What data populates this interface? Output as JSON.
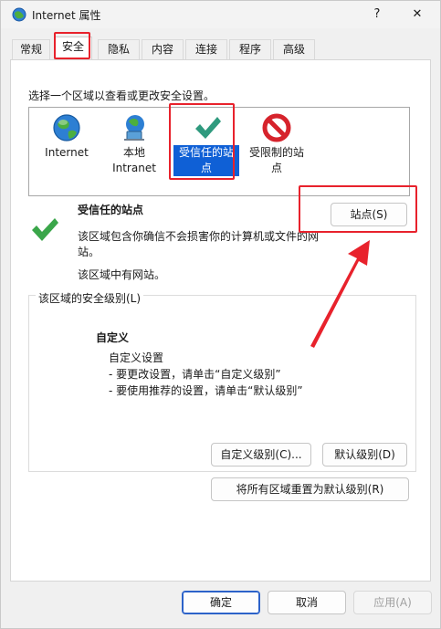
{
  "window": {
    "title": "Internet 属性",
    "help_glyph": "?",
    "close_glyph": "✕"
  },
  "tabs": [
    {
      "label": "常规"
    },
    {
      "label": "安全",
      "active": true
    },
    {
      "label": "隐私"
    },
    {
      "label": "内容"
    },
    {
      "label": "连接"
    },
    {
      "label": "程序"
    },
    {
      "label": "高级"
    }
  ],
  "security": {
    "instruction": "选择一个区域以查看或更改安全设置。",
    "zones": [
      {
        "label": "Internet",
        "icon": "globe-icon"
      },
      {
        "label": "本地\nIntranet",
        "icon": "intranet-icon"
      },
      {
        "label": "受信任的站\n点",
        "icon": "checkmark-icon",
        "selected": true
      },
      {
        "label": "受限制的站\n点",
        "icon": "restricted-icon"
      }
    ],
    "selected_zone_title": "受信任的站点",
    "selected_zone_desc": "该区域包含你确信不会损害你的计算机或文件的网站。",
    "selected_zone_note": "该区域中有网站。",
    "sites_button": "站点(S)",
    "level_group_label": "该区域的安全级别(L)",
    "level_name": "自定义",
    "level_lines": [
      "自定义设置",
      "- 要更改设置，请单击“自定义级别”",
      "- 要使用推荐的设置，请单击“默认级别”"
    ],
    "custom_level_button": "自定义级别(C)...",
    "default_level_button": "默认级别(D)",
    "reset_all_button": "将所有区域重置为默认级别(R)"
  },
  "footer": {
    "ok": "确定",
    "cancel": "取消",
    "apply": "应用(A)"
  },
  "colors": {
    "accent": "#0f60d6",
    "highlight_red": "#e8222c",
    "check_green": "#3aa64a"
  }
}
